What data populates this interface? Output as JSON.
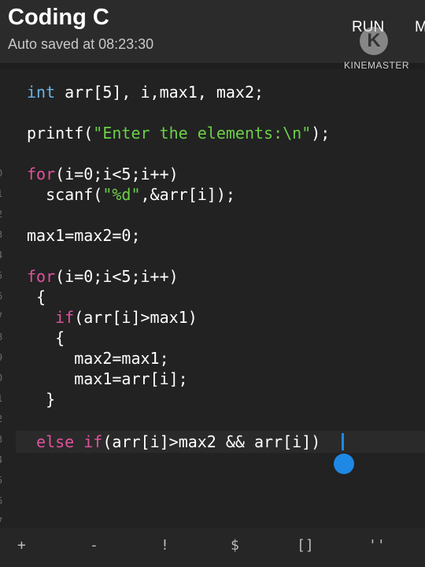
{
  "header": {
    "title": "Coding C",
    "autosave": "Auto saved at 08:23:30",
    "run_label": "RUN",
    "more_label": "M"
  },
  "watermark": {
    "logo": "K",
    "text": "KINEMASTER"
  },
  "gutter": [
    "0",
    "1",
    "2",
    "3",
    "4",
    "5",
    "6",
    "7",
    "8",
    "9",
    "0",
    "1",
    "2",
    "3",
    "4",
    "5",
    "6",
    "7"
  ],
  "code": {
    "l1": [
      "int",
      " arr[5], i,max1, max2;"
    ],
    "l2": [
      "printf(",
      "\"Enter the elements:\\n\"",
      ");"
    ],
    "l3": [
      "for",
      "(i=0;i<5;i++)"
    ],
    "l4": [
      "  scanf(",
      "\"%d\"",
      ",&arr[i]);"
    ],
    "l5": [
      "max1=max2=0;"
    ],
    "l6": [
      "for",
      "(i=0;i<5;i++)"
    ],
    "l7": [
      " {"
    ],
    "l8": [
      "   ",
      "if",
      "(arr[i]>max1)"
    ],
    "l9": [
      "   {"
    ],
    "l10": [
      "     max2=max1;"
    ],
    "l11": [
      "     max1=arr[i];"
    ],
    "l12": [
      "  }"
    ],
    "l13": [
      " ",
      "else",
      " ",
      "if",
      "(arr[i]>max2 && arr[i]",
      ")"
    ]
  },
  "toolbar": {
    "keys": [
      "+",
      "-",
      "!",
      "$",
      "[]",
      "''"
    ]
  },
  "colors": {
    "keyword": "#e0529c",
    "type": "#66b4e8",
    "string": "#6ccf4a",
    "cursor": "#1e88e5"
  }
}
